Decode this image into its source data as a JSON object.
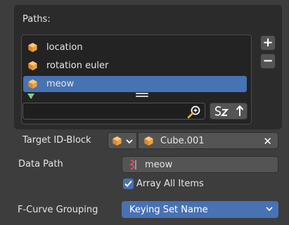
{
  "paths": {
    "label": "Paths:",
    "items": [
      {
        "label": "location",
        "active": false
      },
      {
        "label": "rotation euler",
        "active": false
      },
      {
        "label": "meow",
        "active": true
      }
    ],
    "add_label": "+",
    "remove_label": "−"
  },
  "target": {
    "label": "Target ID-Block",
    "id_name": "Cube.001"
  },
  "data_path": {
    "label": "Data Path",
    "value": "meow"
  },
  "array_all": {
    "label": "Array All Items",
    "checked": true
  },
  "fcurve_grouping": {
    "label": "F-Curve Grouping",
    "value": "Keying Set Name"
  },
  "colors": {
    "accent": "#4772b3",
    "object_icon": "#f0a045",
    "panel": "#2b2b2b",
    "background": "#3d3d3d"
  }
}
